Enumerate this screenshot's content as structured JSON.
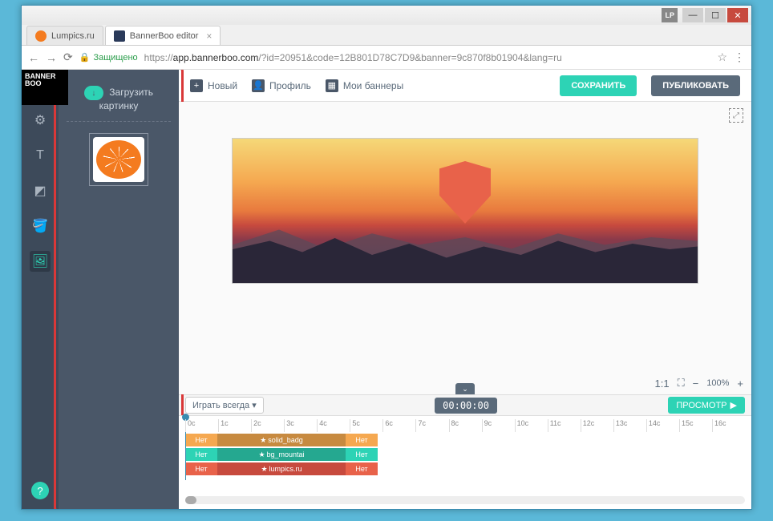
{
  "window": {
    "lp": "LP"
  },
  "tabs": [
    {
      "title": "Lumpics.ru",
      "active": false
    },
    {
      "title": "BannerBoo editor",
      "active": true
    }
  ],
  "addressbar": {
    "secure": "Защищено",
    "url_prefix": "https://",
    "url_domain": "app.bannerboo.com",
    "url_path": "/?id=20951&code=12B801D78C7D9&banner=9c870f8b01904&lang=ru"
  },
  "logo": "BANNER\nBOO",
  "panel": {
    "upload_line1": "Загрузить",
    "upload_line2": "картинку"
  },
  "topbar": {
    "new": "Новый",
    "profile": "Профиль",
    "mybanners": "Мои баннеры",
    "save": "СОХРАНИТЬ",
    "publish": "ПУБЛИКОВАТЬ"
  },
  "zoom": {
    "ratio": "1:1",
    "percent": "100%"
  },
  "playbar": {
    "mode": "Играть всегда",
    "time": "00:00:00",
    "preview": "ПРОСМОТР"
  },
  "timeline": {
    "ticks": [
      "0c",
      "1c",
      "2c",
      "3c",
      "4c",
      "5c",
      "6c",
      "7c",
      "8c",
      "9c",
      "10c",
      "11c",
      "12c",
      "13c",
      "14c",
      "15c",
      "16c"
    ],
    "tracks": [
      {
        "no": "Нет",
        "name": "solid_badg",
        "end": "Нет"
      },
      {
        "no": "Нет",
        "name": "bg_mountai",
        "end": "Нет"
      },
      {
        "no": "Нет",
        "name": "lumpics.ru",
        "end": "Нет"
      }
    ]
  }
}
